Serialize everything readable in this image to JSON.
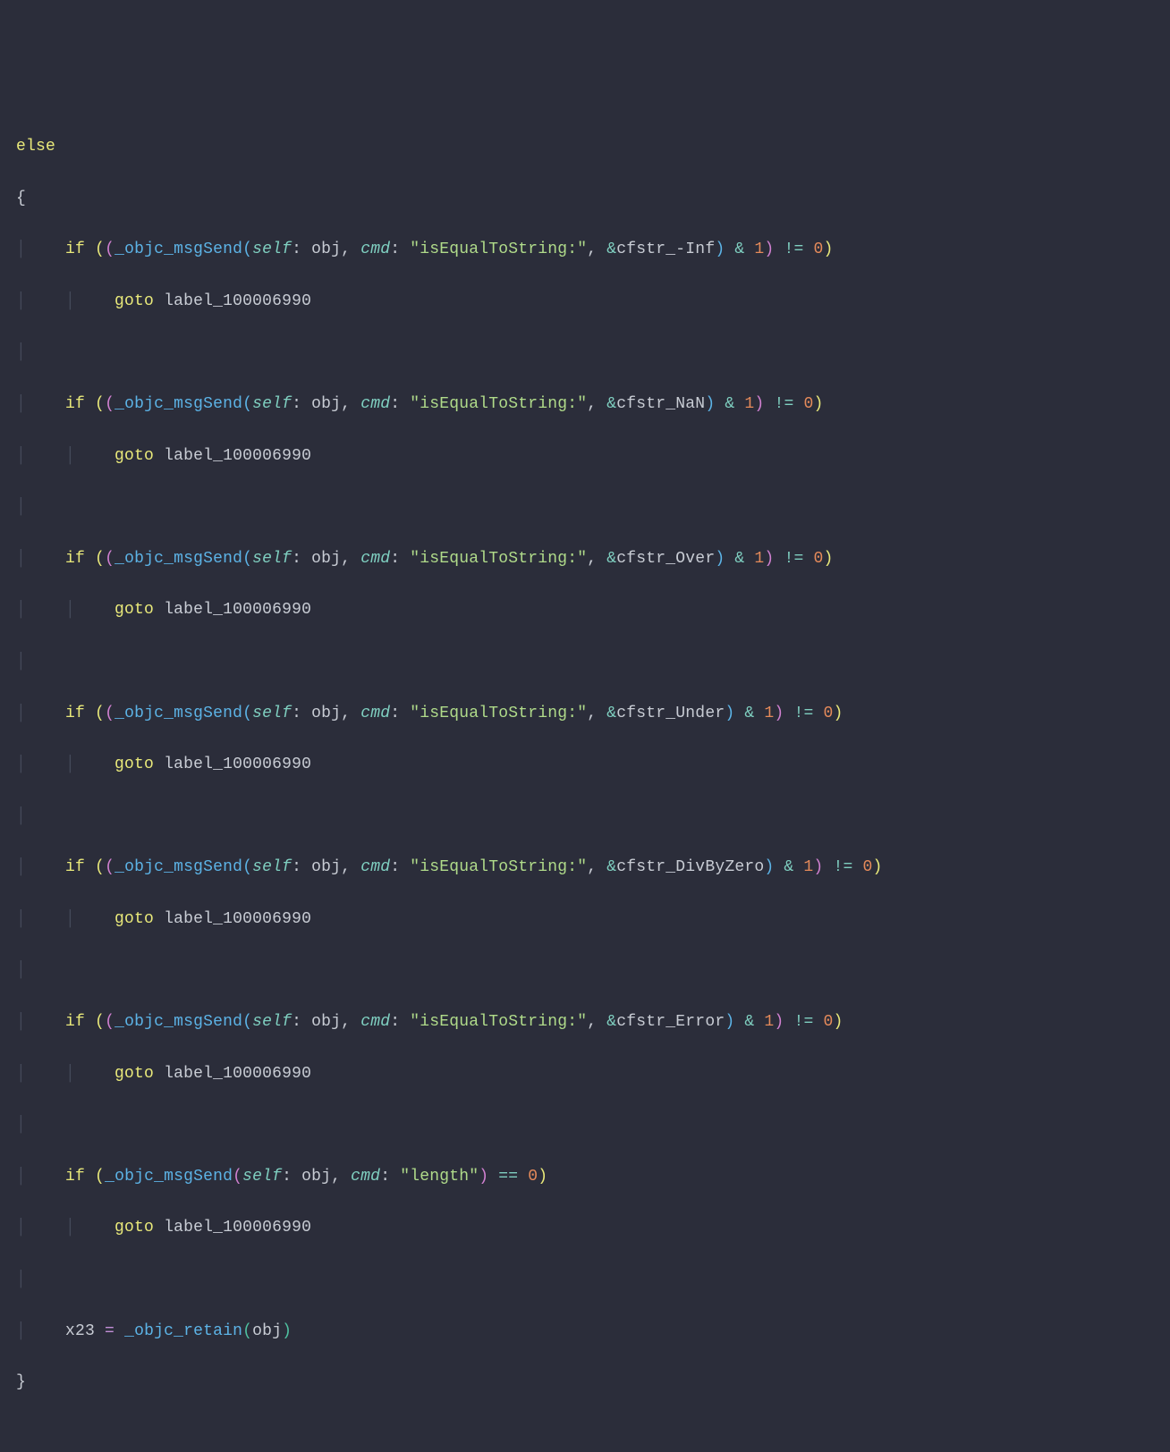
{
  "code": {
    "else_kw": "else",
    "open_brace": "{",
    "close_brace": "}",
    "if_kw": "if",
    "goto_kw": "goto",
    "fn_msgSend": "_objc_msgSend",
    "fn_retain": "_objc_retain",
    "param_self": "self",
    "param_cmd": "cmd",
    "var_obj": "obj",
    "str_isEqualToString": "\"isEqualToString:\"",
    "str_length": "\"length\"",
    "sym_minusInf": "cfstr_-Inf",
    "sym_NaN": "cfstr_NaN",
    "sym_Over": "cfstr_Over",
    "sym_Under": "cfstr_Under",
    "sym_DivByZero": "cfstr_DivByZero",
    "sym_Error": "cfstr_Error",
    "amp": "&",
    "num_1": "1",
    "num_0": "0",
    "op_ne": "!=",
    "op_eq": "==",
    "op_assign": "=",
    "label_goto": "label_100006990",
    "var_x23": "x23",
    "comma": ", ",
    "colon": ": "
  }
}
